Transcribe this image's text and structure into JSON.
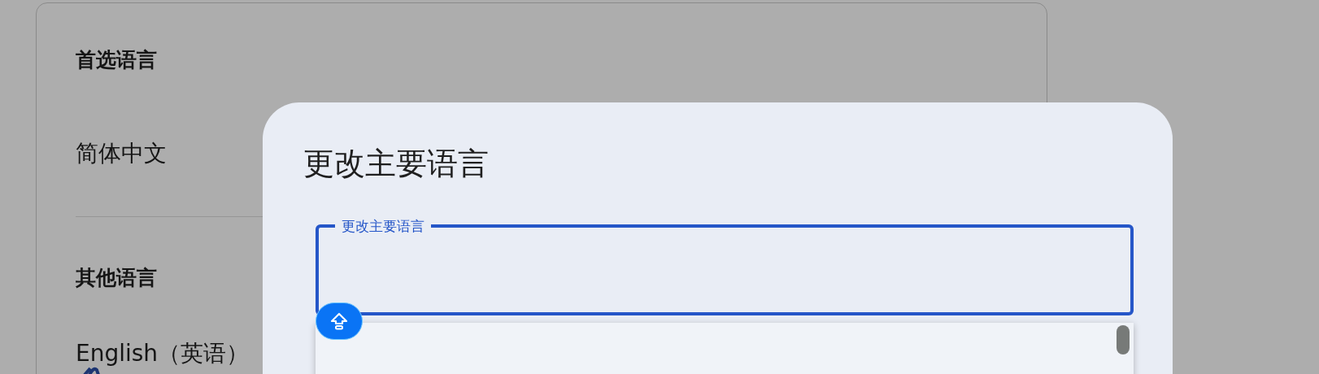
{
  "settings_card": {
    "preferred_heading": "首选语言",
    "preferred_language": "简体中文",
    "other_heading": "其他语言",
    "other_languages": [
      {
        "name": "English（英语）"
      }
    ]
  },
  "dialog": {
    "title": "更改主要语言",
    "field": {
      "label": "更改主要语言",
      "focused": true
    }
  }
}
